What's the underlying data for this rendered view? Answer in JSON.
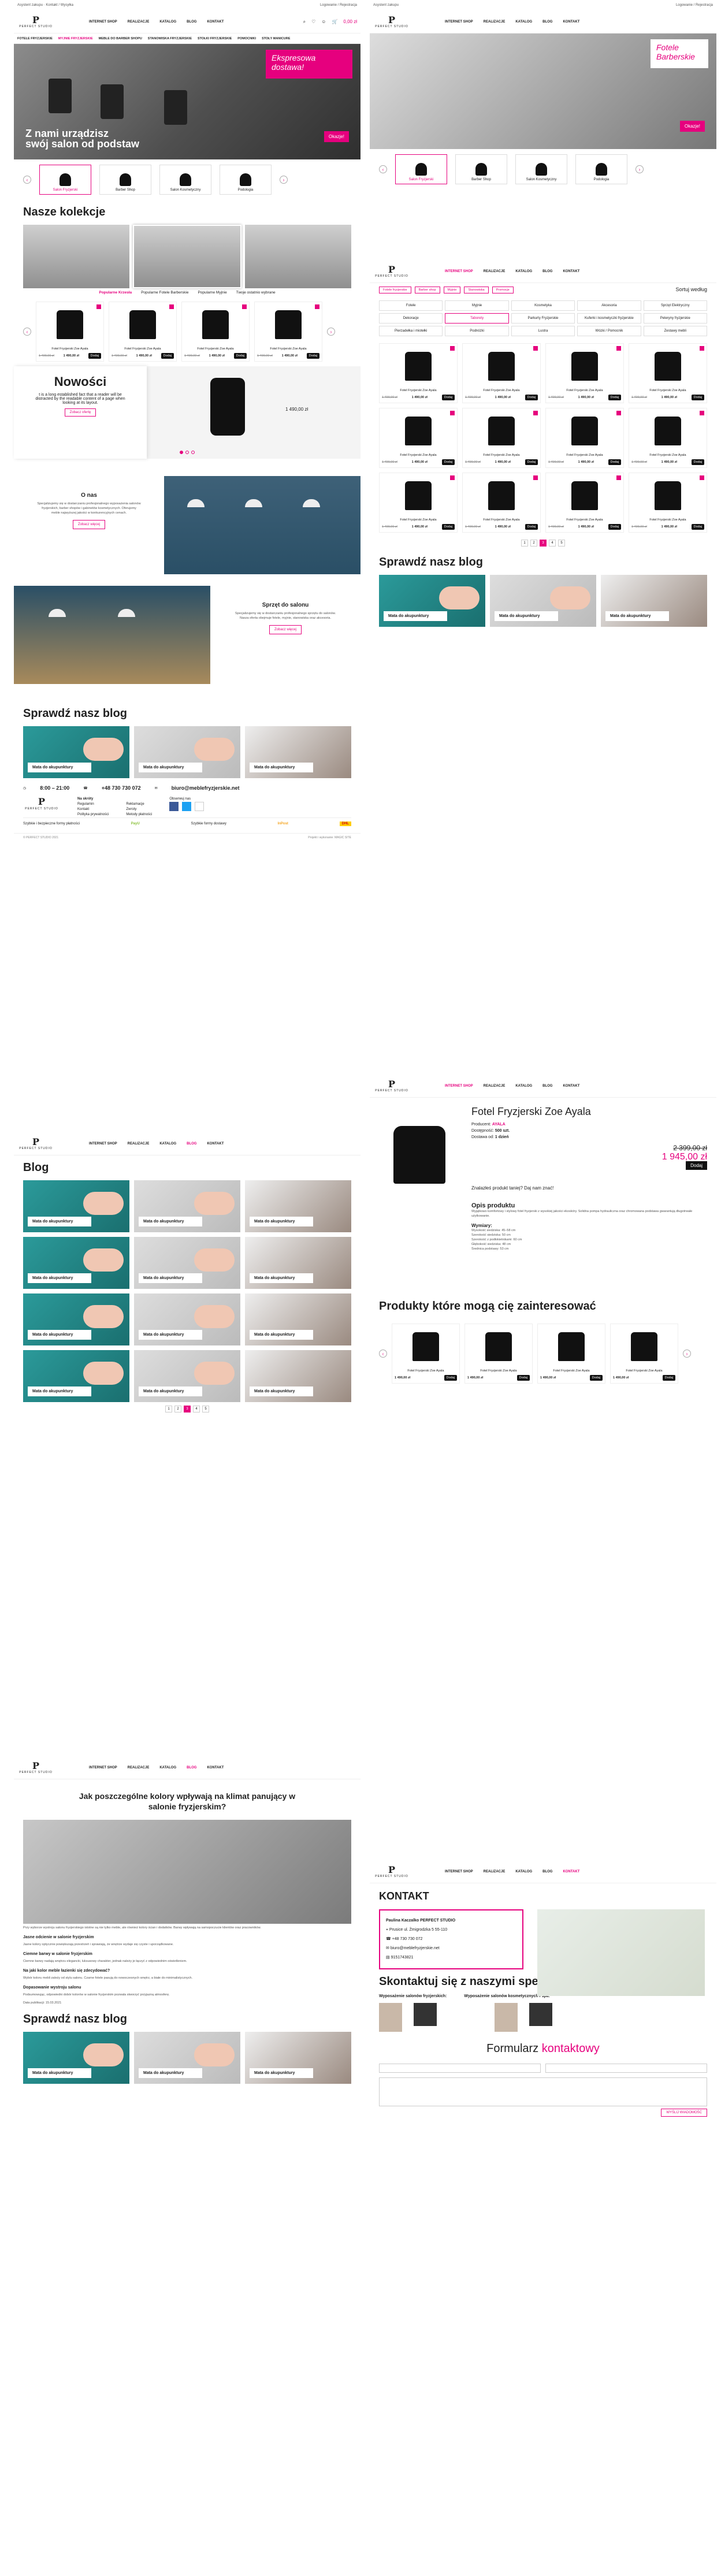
{
  "common": {
    "topbar_left": [
      "Asystent zakupu",
      "Kontakt / Wysyłka"
    ],
    "topbar_right": "Logowanie / Rejestracja",
    "logo_mark": "P",
    "logo_text": "PERFECT STUDIO",
    "nav": [
      "INTERNET SHOP",
      "REALIZACJE",
      "KATALOG",
      "BLOG",
      "KONTAKT"
    ],
    "cart": "0,00 zł",
    "categories": [
      "FOTELE FRYZJERSKIE",
      "MYJNIE FRYZJERSKIE",
      "MEBLE DO BARBER SHOPU",
      "STANOWISKA FRYZJERSKIE",
      "STOŁKI FRYZJERSKIE",
      "POMOCNIKI",
      "STOŁY MANICURE",
      "FOTELE DO PEDICURE",
      "KOSMETOLOGIA",
      "MEBLE RECEPCYJNE",
      "AKCESORIA"
    ],
    "blog_title": "Sprawdź nasz blog",
    "blog_card": "Mata do akupunktury",
    "footer": {
      "hours": "8:00 – 21:00",
      "days": "Poniedziałek – piątek",
      "phone": "+48 730 730 072",
      "email": "biuro@meblefryzjerskie.net",
      "col1_title": "Na skróty",
      "col1": [
        "Regulamin",
        "Kontakt",
        "Polityka prywatności",
        "Cennik"
      ],
      "col2": [
        "Reklamacje",
        "Zwroty",
        "Metody płatności",
        "Realizacja zamówienia"
      ],
      "col3": [
        "Gwarancja",
        "Realizacja zamówienia",
        "Sposób dostawy",
        "Dostawa"
      ],
      "follow": "Obserwuj nas",
      "partners_left": "Szybkie i bezpieczne formy płatności",
      "partners_mid": "Szybkie formy dostawy",
      "payu": "PayU",
      "inpost": "InPost",
      "dhl": "DHL",
      "bottom_left": "© PERFECT STUDIO 2021",
      "bottom_right": "Projekt i wykonanie: MAGIC SITE"
    }
  },
  "home": {
    "promo": "Ekspresowa dostawa!",
    "slogan_1": "Z nami urządzisz",
    "slogan_2": "swój salon od podstaw",
    "okazje": "Okazje!",
    "cats": [
      "Salon Fryzjerski",
      "Barber Shop",
      "Salon Kosmetyczny",
      "Podologia"
    ],
    "collections_title": "Nasze kolekcje",
    "collections_tabs": [
      "Poprzednia kolekcja",
      "Popularna kolekcja",
      "Następna kolekcja"
    ],
    "coll_links": [
      "Popularne Krzesła",
      "Popularne Fotele Barberskie",
      "Popularne Myjnie",
      "Twoje ostatnio wybrane"
    ],
    "product_name": "Fotel Fryzjerski Zoe Ayala",
    "old_price": "1 499,00 zł",
    "new_price": "1 490,00 zł",
    "cart_btn": "Dodaj",
    "new_title": "Nowości",
    "new_text": "t is a long established fact that a reader will be distracted by the readable content of a page when looking at its layout.",
    "new_btn": "Zobacz ofertę",
    "about_title": "O nas",
    "about_text": "Specjalizujemy się w dostarczaniu profesjonalnego wyposażenia salonów fryzjerskich, barber shopów i gabinetów kosmetycznych. Oferujemy meble najwyższej jakości w konkurencyjnych cenach.",
    "about_btn": "Zobacz więcej",
    "equip_title": "Sprzęt do salonu",
    "equip_text": "Specjalizujemy się w dostarczaniu profesjonalnego sprzętu do salonów. Nasza oferta obejmuje fotele, myjnie, stanowiska oraz akcesoria.",
    "equip_btn": "Zobacz więcej"
  },
  "blog": {
    "title": "Blog",
    "pages": [
      "1",
      "2",
      "3",
      "4",
      "5"
    ]
  },
  "article": {
    "title": "Jak poszczególne kolory wpływają na klimat panujący w salonie fryzjerskim?",
    "p1": "Przy wyborze wystroju salonu fryzjerskiego istotne są nie tylko meble, ale również kolory ścian i dodatków. Barwy wpływają na samopoczucie klientów oraz pracowników.",
    "h1": "Jasne odcienie w salonie fryzjerskim",
    "p2": "Jasne kolory optycznie powiększają przestrzeń i sprawiają, że wnętrze wydaje się czyste i uporządkowane.",
    "h2": "Ciemne barwy w salonie fryzjerskim",
    "p3": "Ciemne barwy nadają wnętrzu elegancki, luksusowy charakter, jednak należy je łączyć z odpowiednim oświetleniem.",
    "h3": "Na jaki kolor meble łazienki się zdecydować?",
    "p4": "Wybór koloru mebli zależy od stylu salonu. Czarne fotele pasują do nowoczesnych wnętrz, a białe do minimalistycznych.",
    "h4": "Dopasowanie wystroju salonu",
    "p5": "Podsumowując, odpowiedni dobór kolorów w salonie fryzjerskim pozwala stworzyć przyjazną atmosferę.",
    "date": "Data publikacji: 15.03.2021"
  },
  "listing": {
    "chips": [
      "Fotele fryzjerskie",
      "Barber shop",
      "Myjnie",
      "Stanowiska",
      "Promocje"
    ],
    "sort": "Sortuj według",
    "grid": [
      "Fotele",
      "Myjnie",
      "Kosmetyka",
      "Akcesoria",
      "Sprzęt Elektryczny",
      "Dekoracje",
      "Taborety",
      "Parkurty Fryzjerskie",
      "Kuferki i kosmetyczki fryzjerskie",
      "Peleryny fryzjerskie",
      "Pierzadełka i miotełki",
      "Podnóżki",
      "Lustra",
      "Wózki / Pomocnik",
      "Zestawy mebli"
    ],
    "pages": [
      "1",
      "2",
      "3",
      "4",
      "5"
    ]
  },
  "product": {
    "title": "Fotel Fryzjerski Zoe Ayala",
    "producer_label": "Producent:",
    "producer": "AYALA",
    "avail_label": "Dostępność:",
    "avail": "500 szt.",
    "ship_label": "Dostawa od:",
    "ship": "1 dzień",
    "old": "2 399,00 zł",
    "price": "1 945,00 zł",
    "add": "Dodaj",
    "cheaper": "Znalazłeś produkt taniej? Daj nam znać!",
    "desc_title": "Opis produktu",
    "desc": "Wyjątkowo komfortowy i stylowy fotel fryzjerski z wysokiej jakości ekoskóry. Solidna pompa hydrauliczna oraz chromowana podstawa gwarantują długotrwałe użytkowanie.",
    "dims_title": "Wymiary:",
    "dims": [
      "Wysokość siedziska: 45–58 cm",
      "Szerokość siedziska: 50 cm",
      "Szerokość z podłokietnikami: 60 cm",
      "Głębokość siedziska: 48 cm",
      "Średnica podstawy: 53 cm"
    ],
    "related": "Produkty które mogą cię zainteresować"
  },
  "contact": {
    "title": "KONTAKT",
    "company": "Paulina Kaczalko PERFECT STUDIO",
    "addr": "Prusice ul. Żmigrodzka 5 55-110",
    "phone": "+48 730 730 072",
    "email": "biuro@meblefryzjerskie.net",
    "nip": "9151743821",
    "spec_title": "Skontaktuj się z naszymi specjalistami",
    "spec_a": "Wyposażenie salonów fryzjerskich:",
    "spec_b": "Wyposażenie salonów kosmetycznych i spa:",
    "form_title_1": "Formularz ",
    "form_title_2": "kontaktowy",
    "form_btn": "WYŚLIJ WIADOMOŚĆ"
  }
}
